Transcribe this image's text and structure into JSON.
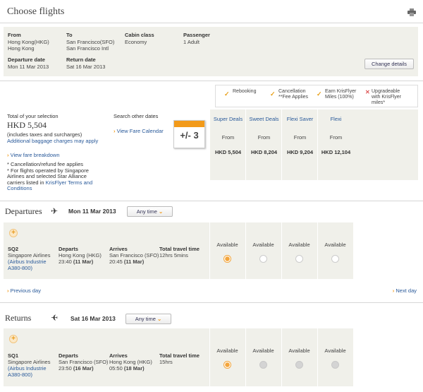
{
  "header": {
    "title": "Choose flights",
    "print_icon": "printer-icon"
  },
  "summary": {
    "from_label": "From",
    "from_code": "Hong Kong(HKG)",
    "from_city": "Hong Kong",
    "to_label": "To",
    "to_code": "San Francisco(SFO)",
    "to_city": "San Francisco Intl",
    "cabin_label": "Cabin class",
    "cabin_value": "Economy",
    "passenger_label": "Passenger",
    "passenger_value": "1 Adult",
    "depart_label": "Departure date",
    "depart_value": "Mon 11 Mar 2013",
    "return_label": "Return date",
    "return_value": "Sat 16 Mar 2013",
    "change_btn": "Change details"
  },
  "features": [
    {
      "label": "Rebooking",
      "icon": "tick"
    },
    {
      "label": "Cancellation",
      "label2": "**Fee Applies",
      "icon": "tick"
    },
    {
      "label": "Earn KrisFlyer",
      "label2": "Miles (100%)",
      "icon": "tick"
    },
    {
      "label": "Upgradeable",
      "label2": "with KrisFlyer",
      "label3": "miles*",
      "icon": "cross"
    }
  ],
  "total": {
    "label": "Total of your selection",
    "amount": "HKD 5,504",
    "note": "(includes taxes and surcharges)",
    "baggage": "Additional baggage charges may apply",
    "breakdown": "View fare breakdown",
    "footnote1": "* Cancellation/refund fee applies",
    "footnote2a": "* For flights operated by Singapore",
    "footnote2b": "Airlines and selected Star Alliance",
    "footnote2c": "carriers listed in ",
    "footnote2link": "KrisFlyer Terms and",
    "footnote2d": "Conditions"
  },
  "search": {
    "label": "Search other dates",
    "calendar_link": "View Fare Calendar",
    "calendar_badge": "+/- 3"
  },
  "fares": [
    {
      "name": "Super Deals",
      "from": "From",
      "price": "HKD 5,504"
    },
    {
      "name": "Sweet Deals",
      "from": "From",
      "price": "HKD 8,204"
    },
    {
      "name": "Flexi Saver",
      "from": "From",
      "price": "HKD 9,204"
    },
    {
      "name": "Flexi",
      "from": "From",
      "price": "HKD 12,104"
    }
  ],
  "departures": {
    "title": "Departures",
    "date": "Mon 11 Mar 2013",
    "any_time": "Any time",
    "flight": "SQ2",
    "airline": "Singapore Airlines",
    "aircraft1": "(Airbus Industrie",
    "aircraft2": "A380-800)",
    "departs_label": "Departs",
    "departs_place": "Hong Kong (HKG)",
    "departs_time": "23:40",
    "departs_date": "(11 Mar)",
    "arrives_label": "Arrives",
    "arrives_place": "San Francisco (SFO)",
    "arrives_time": "20:45",
    "arrives_date": "(11 Mar)",
    "travel_label": "Total travel time",
    "travel_value": "12hrs 5mins",
    "availability": [
      "Available",
      "Available",
      "Available",
      "Available"
    ],
    "prev": "Previous day",
    "next": "Next day"
  },
  "returns": {
    "title": "Returns",
    "date": "Sat 16 Mar 2013",
    "any_time": "Any time",
    "flight": "SQ1",
    "airline": "Singapore Airlines",
    "aircraft1": "(Airbus Industrie",
    "aircraft2": "A380-800)",
    "departs_label": "Departs",
    "departs_place": "San Francisco (SFO)",
    "departs_time": "23:50",
    "departs_date": "(16 Mar)",
    "arrives_label": "Arrives",
    "arrives_place": "Hong Kong (HKG)",
    "arrives_time": "05:50",
    "arrives_date": "(18 Mar)",
    "travel_label": "Total travel time",
    "travel_value": "15hrs",
    "availability": [
      "Available",
      "Available",
      "Available",
      "Available"
    ]
  },
  "colors": {
    "accent": "#f29a1a",
    "link": "#2a5a9a",
    "panel": "#f0f0ea"
  }
}
